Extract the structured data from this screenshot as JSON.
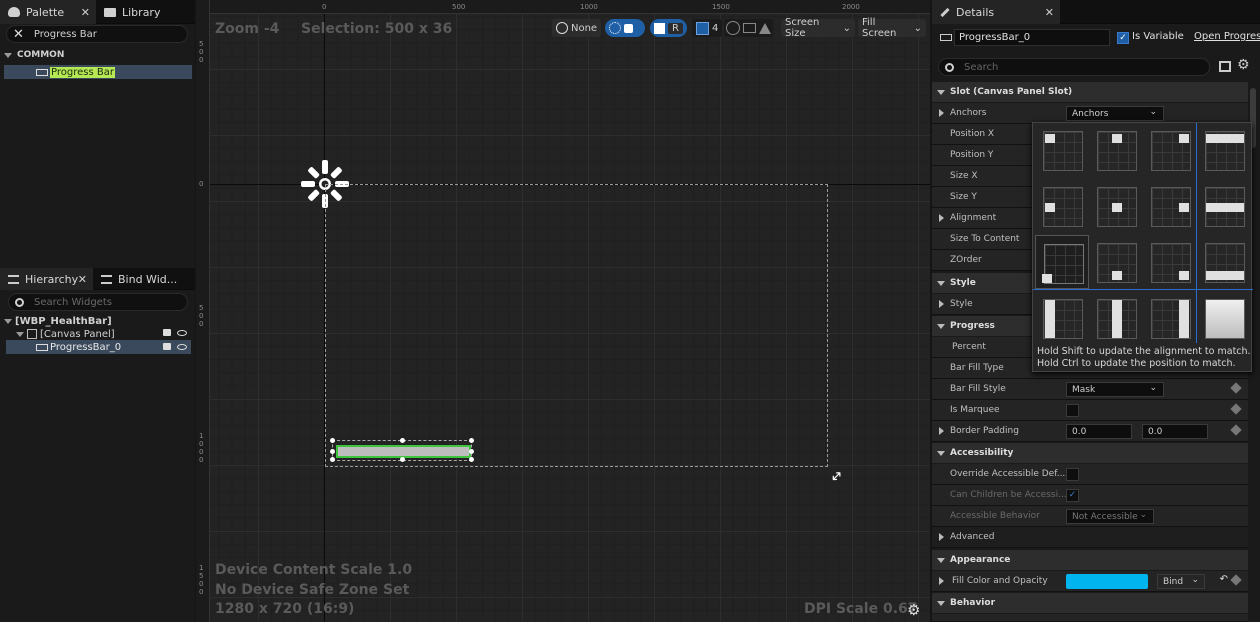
{
  "palette": {
    "tab_palette": "Palette",
    "tab_library": "Library",
    "search_value": "Progress Bar",
    "category": "COMMON",
    "item": "Progress Bar"
  },
  "hierarchy": {
    "tab_hierarchy": "Hierarchy",
    "tab_bind": "Bind Wid...",
    "search_placeholder": "Search Widgets",
    "root": "[WBP_HealthBar]",
    "canvas_panel": "[Canvas Panel]",
    "progress_bar": "ProgressBar_0"
  },
  "designer": {
    "zoom": "Zoom -4",
    "selection": "Selection: 500 x 36",
    "toolbar": {
      "none_label": "None",
      "r_label": "R",
      "grid_num": "4",
      "screen_size": "Screen Size",
      "fill_screen": "Fill Screen"
    },
    "ruler_h": [
      "0",
      "500",
      "1000",
      "1500",
      "2000"
    ],
    "ruler_v": [
      "5\n0\n0",
      "0",
      "5\n0\n0",
      "1\n0\n0\n0",
      "1\n5\n0\n0"
    ],
    "device_content_scale": "Device Content Scale 1.0",
    "safe_zone": "No Device Safe Zone Set",
    "resolution": "1280 x 720 (16:9)",
    "dpi_scale": "DPI Scale 0.67"
  },
  "details": {
    "tab": "Details",
    "widget_name": "ProgressBar_0",
    "is_variable": "Is Variable",
    "open_link": "Open Progres",
    "search_placeholder": "Search",
    "sections": {
      "slot": "Slot (Canvas Panel Slot)",
      "style": "Style",
      "progress": "Progress",
      "accessibility": "Accessibility",
      "advanced": "Advanced",
      "appearance": "Appearance",
      "behavior": "Behavior"
    },
    "props": {
      "anchors": "Anchors",
      "anchors_value": "Anchors",
      "position_x": "Position X",
      "position_y": "Position Y",
      "size_x": "Size X",
      "size_y": "Size Y",
      "alignment": "Alignment",
      "size_to_content": "Size To Content",
      "zorder": "ZOrder",
      "style": "Style",
      "percent": "Percent",
      "bar_fill_type": "Bar Fill Type",
      "bar_fill_style": "Bar Fill Style",
      "bar_fill_style_value": "Mask",
      "is_marquee": "Is Marquee",
      "border_padding": "Border Padding",
      "border_padding_l": "0.0",
      "border_padding_r": "0.0",
      "override_accessible": "Override Accessible Def...",
      "can_children": "Can Children be Accessi...",
      "accessible_behavior": "Accessible Behavior",
      "accessible_behavior_value": "Not Accessible",
      "fill_color": "Fill Color and Opacity",
      "bind": "Bind"
    },
    "anchor_hint_1": "Hold Shift to update the alignment to match.",
    "anchor_hint_2": "Hold Ctrl to update the position to match."
  },
  "colors": {
    "accent": "#1f5fa6",
    "fill_color": "#00b4f0",
    "selection_green": "#3fc43f",
    "palette_highlight": "#b5e853"
  }
}
